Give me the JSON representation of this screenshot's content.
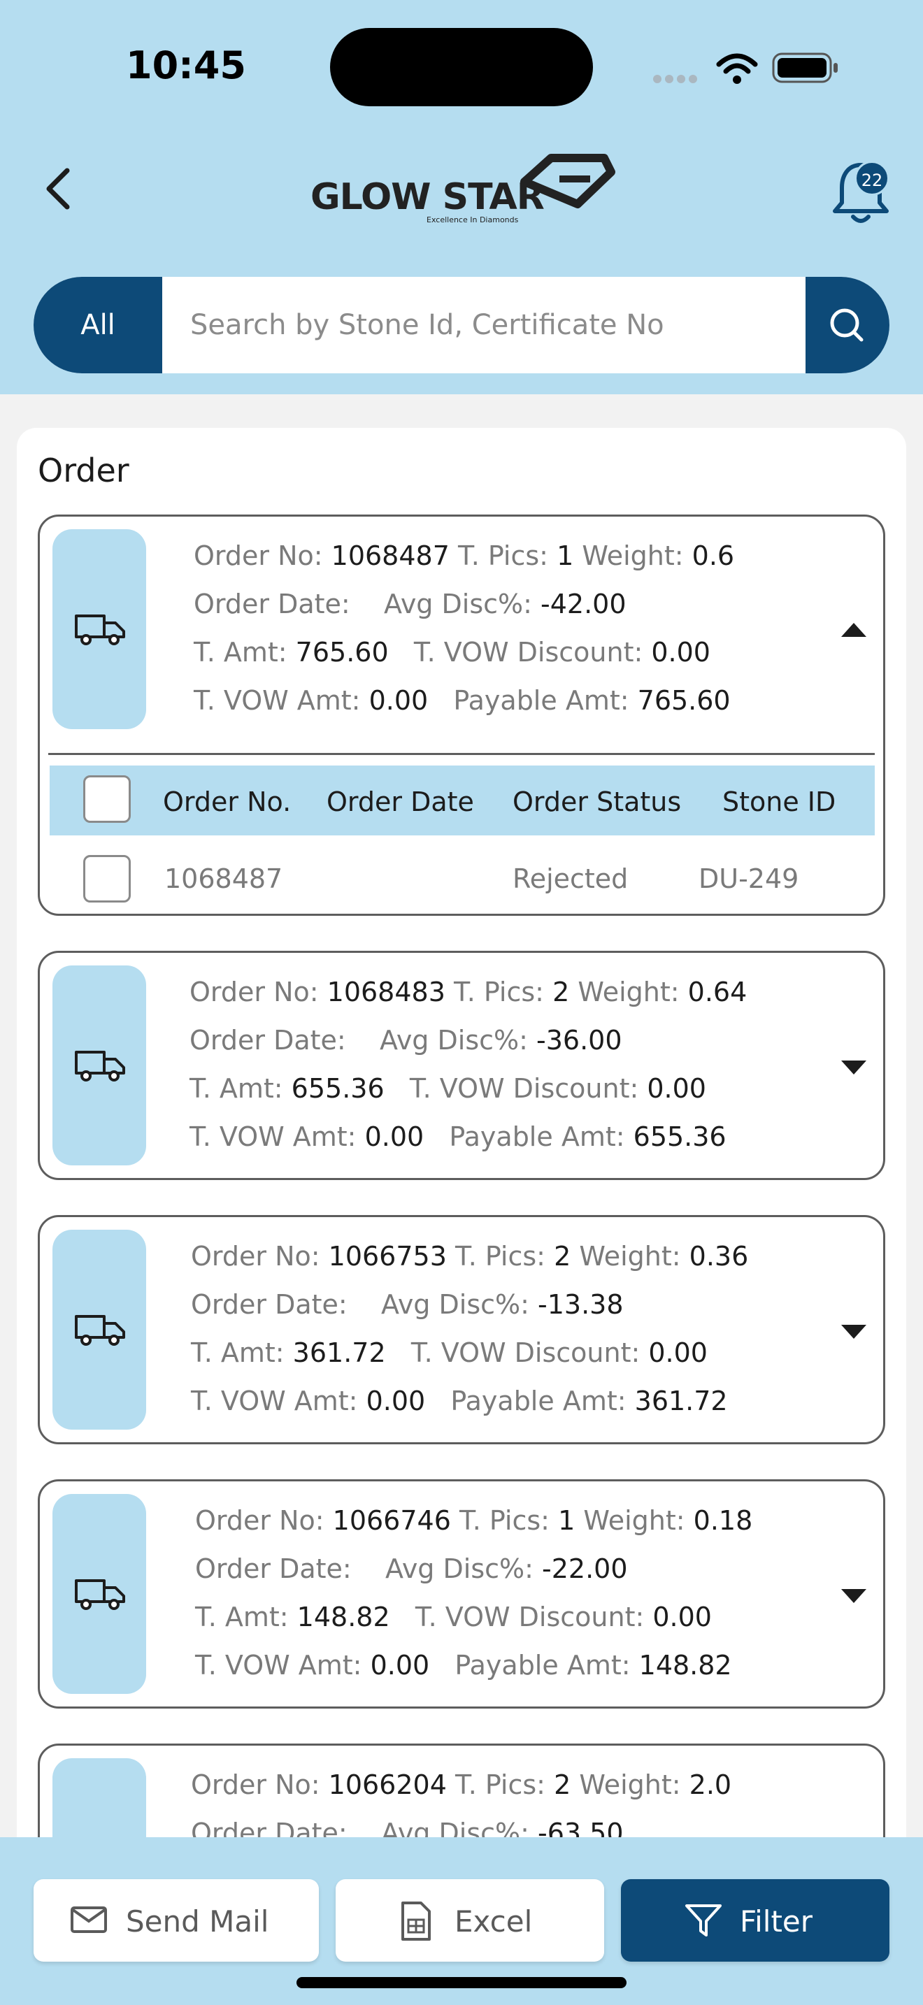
{
  "status_bar": {
    "time": "10:45"
  },
  "header": {
    "logo_text": "GLOW STAR",
    "logo_tagline": "Excellence In Diamonds",
    "notification_count": "22"
  },
  "search": {
    "scope_label": "All",
    "placeholder": "Search by Stone Id, Certificate No"
  },
  "section_title": "Order",
  "labels": {
    "order_no": "Order No:",
    "t_pics": "T. Pics:",
    "weight": "Weight:",
    "order_date": "Order Date:",
    "avg_disc": "Avg Disc%:",
    "t_amt": "T. Amt:",
    "t_vow_discount": "T. VOW Discount:",
    "t_vow_amt": "T. VOW Amt:",
    "payable_amt": "Payable Amt:"
  },
  "orders": [
    {
      "order_no": "1068487",
      "t_pics": "1",
      "weight": "0.6",
      "order_date": "",
      "avg_disc": "-42.00",
      "t_amt": "765.60",
      "t_vow_discount": "0.00",
      "t_vow_amt": "0.00",
      "payable_amt": "765.60",
      "expanded": true
    },
    {
      "order_no": "1068483",
      "t_pics": "2",
      "weight": "0.64",
      "order_date": "",
      "avg_disc": "-36.00",
      "t_amt": "655.36",
      "t_vow_discount": "0.00",
      "t_vow_amt": "0.00",
      "payable_amt": "655.36",
      "expanded": false
    },
    {
      "order_no": "1066753",
      "t_pics": "2",
      "weight": "0.36",
      "order_date": "",
      "avg_disc": "-13.38",
      "t_amt": "361.72",
      "t_vow_discount": "0.00",
      "t_vow_amt": "0.00",
      "payable_amt": "361.72",
      "expanded": false
    },
    {
      "order_no": "1066746",
      "t_pics": "1",
      "weight": "0.18",
      "order_date": "",
      "avg_disc": "-22.00",
      "t_amt": "148.82",
      "t_vow_discount": "0.00",
      "t_vow_amt": "0.00",
      "payable_amt": "148.82",
      "expanded": false
    },
    {
      "order_no": "1066204",
      "t_pics": "2",
      "weight": "2.0",
      "order_date": "",
      "avg_disc": "-63.50"
    }
  ],
  "detail_table": {
    "columns": [
      "Order No.",
      "Order Date",
      "Order Status",
      "Stone ID"
    ],
    "rows": [
      {
        "order_no": "1068487",
        "order_date": "",
        "order_status": "Rejected",
        "stone_id": "DU-249"
      }
    ]
  },
  "bottom_bar": {
    "send_mail": "Send Mail",
    "excel": "Excel",
    "filter": "Filter"
  },
  "colors": {
    "accent_light": "#b5ddf0",
    "accent_dark": "#0d4a78"
  }
}
